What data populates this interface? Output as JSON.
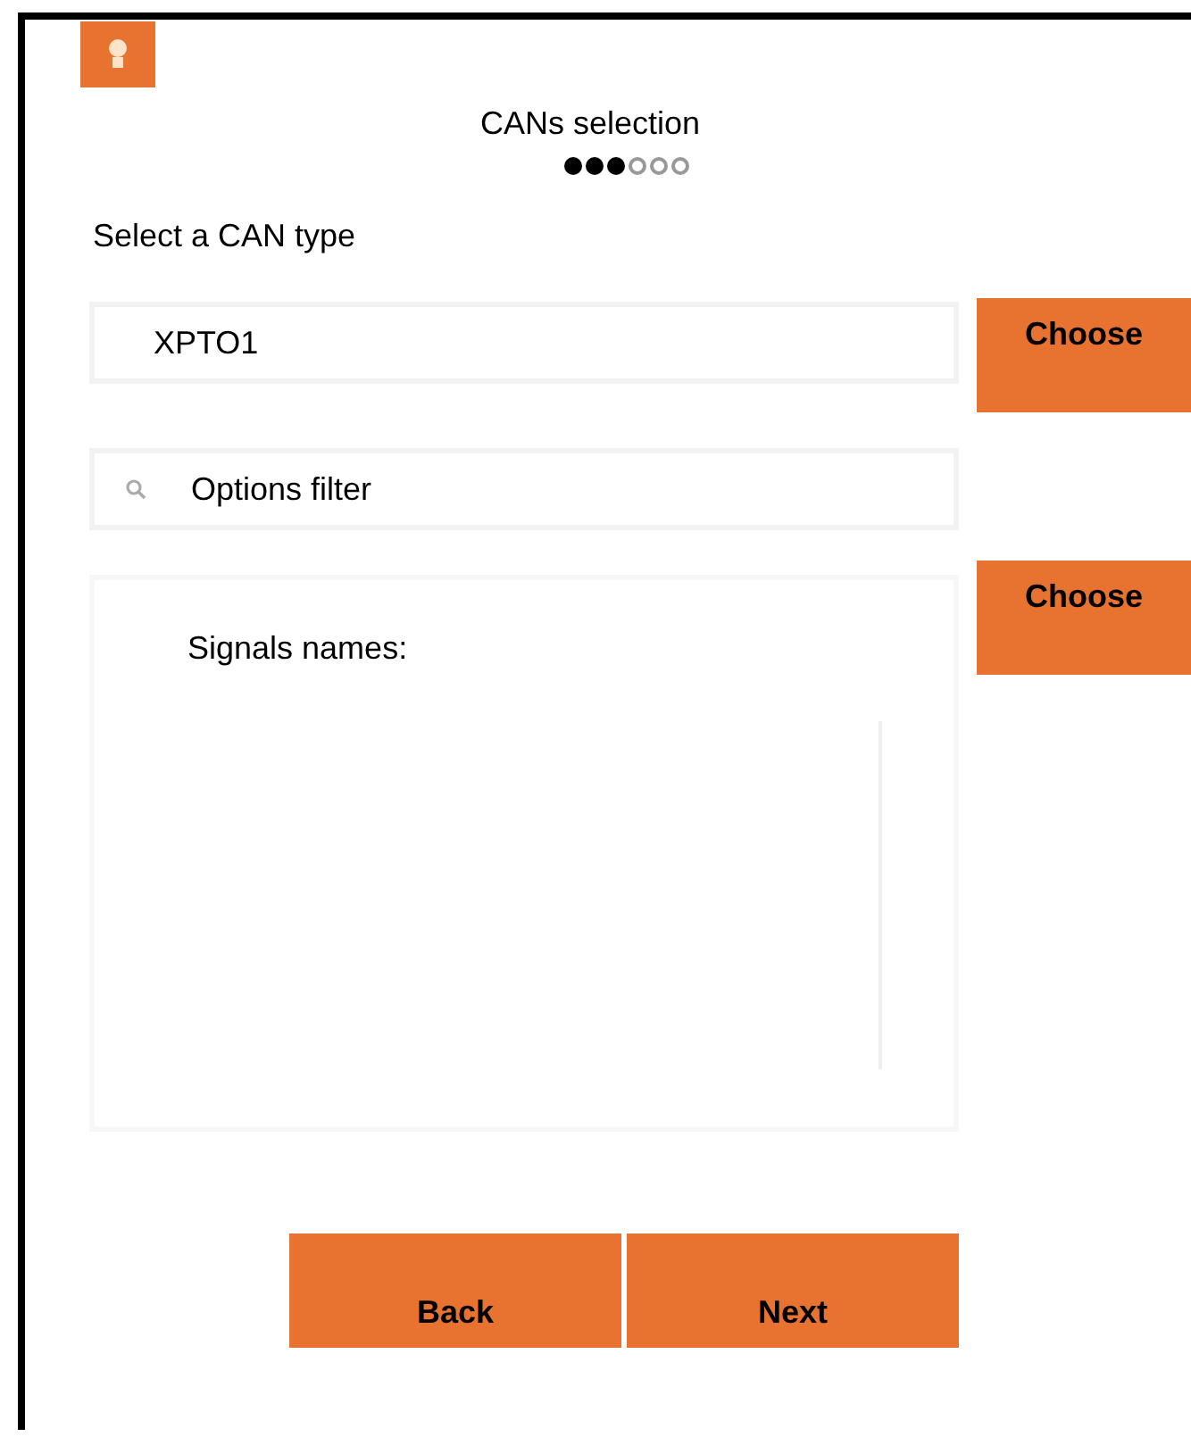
{
  "header": {
    "title": "CANs selection",
    "steps": [
      {
        "filled": true
      },
      {
        "filled": true
      },
      {
        "filled": true
      },
      {
        "filled": false
      },
      {
        "filled": false
      },
      {
        "filled": false
      }
    ]
  },
  "can_type": {
    "label": "Select a CAN type",
    "value": "XPTO1",
    "button": "Choose"
  },
  "filter": {
    "placeholder": "Options filter"
  },
  "signals": {
    "label": "Signals names:",
    "button": "Choose"
  },
  "buttons": [
    "Back",
    "Next"
  ]
}
